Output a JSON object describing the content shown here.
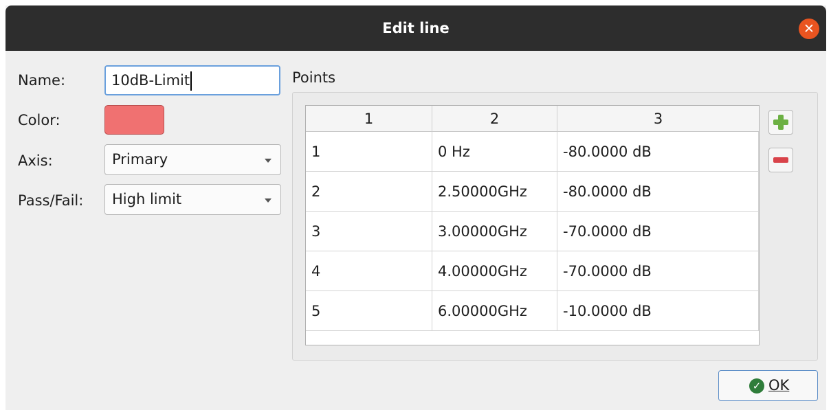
{
  "window": {
    "title": "Edit line"
  },
  "form": {
    "name_label": "Name:",
    "name_value": "10dB-Limit",
    "color_label": "Color:",
    "color_value": "#f07171",
    "axis_label": "Axis:",
    "axis_value": "Primary",
    "passfail_label": "Pass/Fail:",
    "passfail_value": "High limit"
  },
  "points": {
    "group_title": "Points",
    "headers": [
      "1",
      "2",
      "3"
    ],
    "rows": [
      [
        "1",
        "0 Hz",
        "-80.0000 dB"
      ],
      [
        "2",
        "2.50000GHz",
        "-80.0000 dB"
      ],
      [
        "3",
        "3.00000GHz",
        "-70.0000 dB"
      ],
      [
        "4",
        "4.00000GHz",
        "-70.0000 dB"
      ],
      [
        "5",
        "6.00000GHz",
        "-10.0000 dB"
      ]
    ],
    "add_icon": "plus-icon",
    "remove_icon": "minus-icon"
  },
  "buttons": {
    "ok_label": "OK"
  },
  "colors": {
    "accent": "#e95420",
    "add": "#6cb043",
    "remove": "#d9434a",
    "ok_check": "#2f7d3a"
  }
}
